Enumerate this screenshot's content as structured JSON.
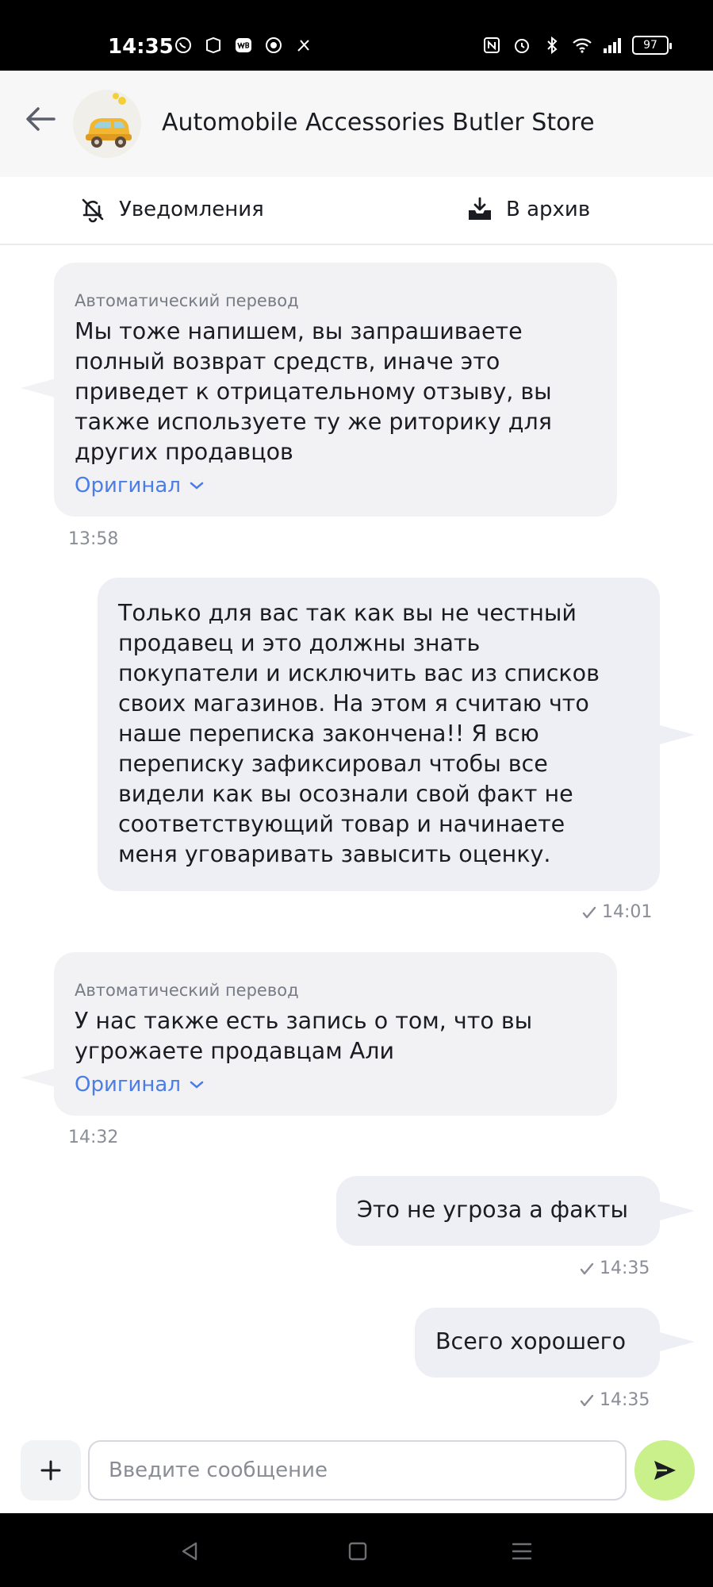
{
  "status_bar": {
    "time": "14:35",
    "left_icons": [
      "whatsapp-icon",
      "app-icon",
      "wb-icon",
      "target-icon",
      "tool-icon"
    ],
    "right_icons": [
      "nfc-icon",
      "alarm-icon",
      "bluetooth-icon",
      "wifi-icon",
      "signal-icon"
    ],
    "battery": "97"
  },
  "header": {
    "title": "Automobile Accessories Butler Store",
    "back_icon": "arrow-left-icon",
    "avatar_icon": "toy-car-icon"
  },
  "actions": {
    "notifications": "Уведомления",
    "archive": "В архив"
  },
  "messages": [
    {
      "direction": "in",
      "auto_label": "Автоматический перевод",
      "lines": [
        "Мы тоже напишем, вы запрашиваете",
        "полный возврат средств, иначе это",
        "приведет к отрицательному отзыву, вы",
        "также используете ту же риторику для",
        "других продавцов"
      ],
      "original_label": "Оригинал",
      "time": "13:58"
    },
    {
      "direction": "out",
      "lines": [
        "Только для вас так как вы не честный",
        "продавец   и это должны знать",
        "покупатели и исключить вас из списков",
        "своих магазинов. На этом я считаю что",
        "наше переписка закончена!! Я всю",
        "переписку зафиксировал чтобы все",
        "видели как вы осознали свой факт не",
        "соответствующий товар и начинаете",
        "меня уговаривать завысить оценку."
      ],
      "time": "14:01"
    },
    {
      "direction": "in",
      "auto_label": "Автоматический перевод",
      "lines": [
        "У нас также есть запись о том, что вы",
        "угрожаете продавцам Али"
      ],
      "original_label": "Оригинал",
      "time": "14:32"
    },
    {
      "direction": "out",
      "lines": [
        "Это не угроза а факты"
      ],
      "time": "14:35"
    },
    {
      "direction": "out",
      "lines": [
        "Всего хорошего"
      ],
      "time": "14:35"
    }
  ],
  "composer": {
    "placeholder": "Введите сообщение",
    "value": ""
  },
  "colors": {
    "accent": "#4a7ee6",
    "send_button": "#c9f08a",
    "incoming_bubble": "#f2f2f4",
    "outgoing_bubble": "#edeff5"
  }
}
